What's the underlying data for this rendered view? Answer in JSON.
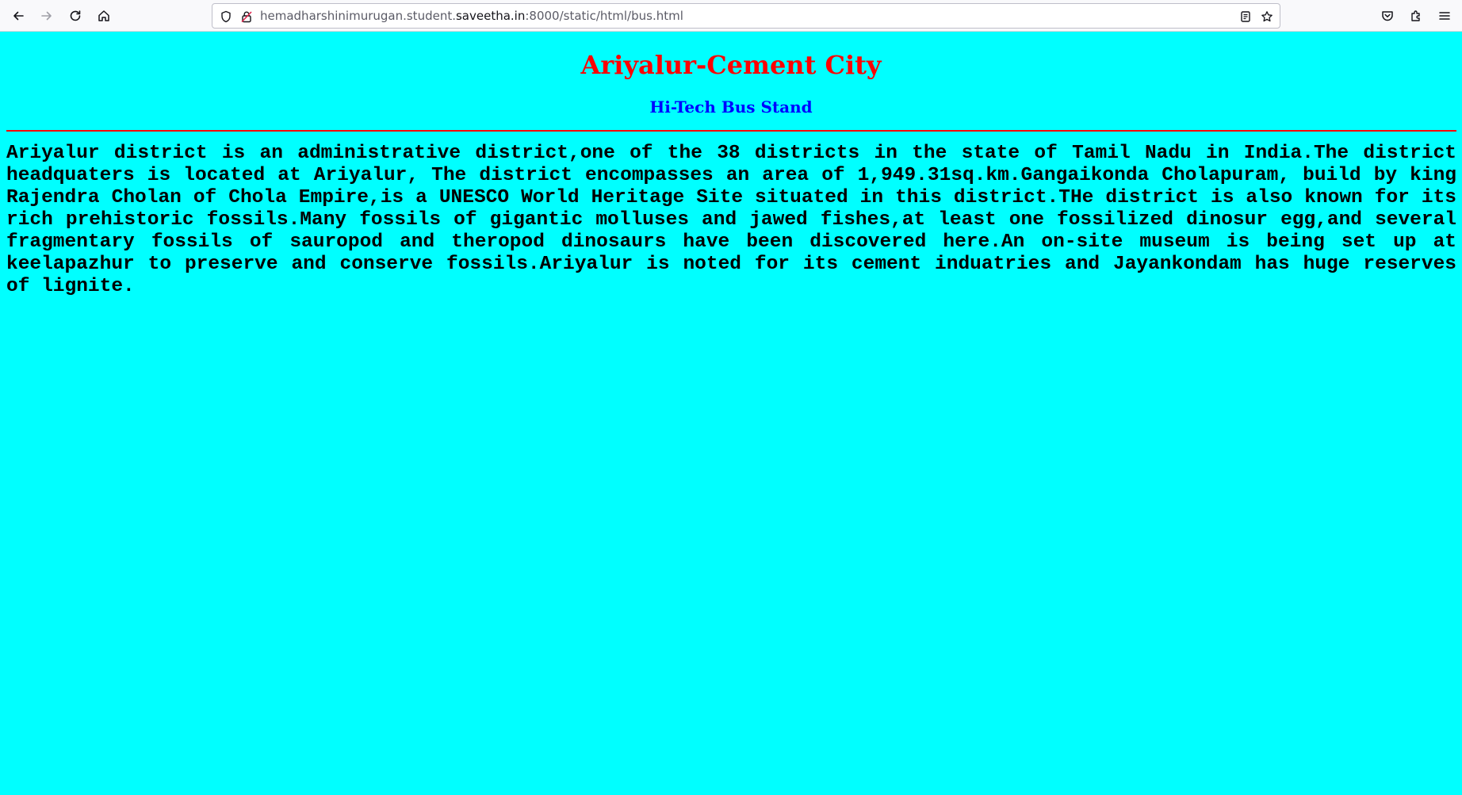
{
  "browser": {
    "url": {
      "prefix": "hemadharshinimurugan.student.",
      "domain": "saveetha.in",
      "suffix": ":8000/static/html/bus.html"
    },
    "icons": {
      "back": "back-arrow-icon",
      "forward": "forward-arrow-icon",
      "reload": "reload-icon",
      "home": "home-icon",
      "shield": "shield-icon",
      "lock": "insecure-lock-icon",
      "reader": "reader-view-icon",
      "bookmark": "star-icon",
      "pocket": "pocket-icon",
      "extensions": "extensions-icon",
      "menu": "hamburger-menu-icon"
    }
  },
  "page": {
    "title": "Ariyalur-Cement City",
    "subtitle": "Hi-Tech Bus Stand",
    "paragraph": "Ariyalur district is an administrative district,one of the 38 districts in the state of Tamil Nadu in India.The district headquaters is located at Ariyalur, The district encompasses an area of 1,949.31sq.km.Gangaikonda Cholapuram, build by king Rajendra Cholan of Chola Empire,is a UNESCO World Heritage Site situated in this district.THe district is also known for its rich prehistoric fossils.Many fossils of gigantic molluses and jawed fishes,at least one fossilized dinosur egg,and several fragmentary fossils of sauropod and theropod dinosaurs have been discovered here.An on-site museum is being set up at keelapazhur to preserve and conserve fossils.Ariyalur is noted for its cement induatries and Jayankondam has huge reserves of lignite."
  },
  "colors": {
    "background": "#00ffff",
    "title": "#ff0000",
    "subtitle": "#0000ff",
    "rule": "#ff0000",
    "text": "#000000"
  }
}
